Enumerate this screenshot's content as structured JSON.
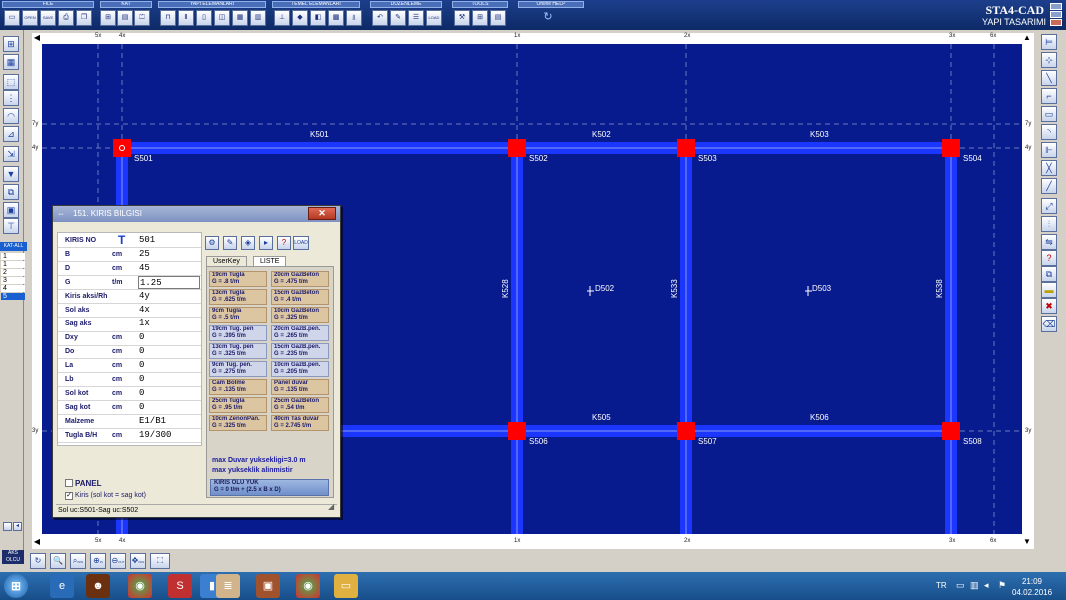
{
  "app": {
    "brand": "STA4-CAD",
    "brand_sub": "YAPI TASARIMI"
  },
  "toolbar_groups": [
    {
      "title": "FILE"
    },
    {
      "title": "KAT"
    },
    {
      "title": "YAPI ELEMANLARI"
    },
    {
      "title": "TEMEL ELEMANLARI"
    },
    {
      "title": "DUZENLEME"
    },
    {
      "title": "TOOLS"
    },
    {
      "title": "Online HELP"
    }
  ],
  "toolbar_buttons": {
    "open": "OPEN",
    "save": "SAVE",
    "load": "LOAD",
    "load2": "LOAD"
  },
  "left": {
    "kat_all": "KAT-ALL",
    "floors": [
      "1",
      "1",
      "2",
      "3",
      "4",
      "5"
    ],
    "selected_floor_index": 5
  },
  "axes": {
    "top": [
      "5x",
      "4x",
      "1x",
      "2x",
      "3x",
      "6x"
    ],
    "left": [
      "7y",
      "4y",
      "3y"
    ],
    "right": [
      "7y",
      "4y",
      "3y"
    ]
  },
  "plan": {
    "beams_h": [
      "K501",
      "K502",
      "K503",
      "K505",
      "K506"
    ],
    "beams_v": [
      "K528",
      "K533",
      "K538"
    ],
    "columns": [
      "S501",
      "S502",
      "S503",
      "S504",
      "S506",
      "S507",
      "S508"
    ],
    "slabs": [
      "D502",
      "D503"
    ]
  },
  "dialog": {
    "title": "151. KIRIS BILGISI",
    "close": "✕",
    "fields": [
      {
        "label": "KIRIS NO",
        "unit": "",
        "value": "501"
      },
      {
        "label": "B",
        "unit": "cm",
        "value": "25"
      },
      {
        "label": "D",
        "unit": "cm",
        "value": "45"
      },
      {
        "label": "G",
        "unit": "t/m",
        "value": "1.25"
      },
      {
        "label": "Kiris aksi/Rh",
        "unit": "",
        "value": "4y"
      },
      {
        "label": "Sol aks",
        "unit": "",
        "value": "4x"
      },
      {
        "label": "Sag aks",
        "unit": "",
        "value": "1x"
      },
      {
        "label": "Dxy",
        "unit": "cm",
        "value": "0"
      },
      {
        "label": "Do",
        "unit": "cm",
        "value": "0"
      },
      {
        "label": "La",
        "unit": "cm",
        "value": "0"
      },
      {
        "label": "Lb",
        "unit": "cm",
        "value": "0"
      },
      {
        "label": "Sol kot",
        "unit": "cm",
        "value": "0"
      },
      {
        "label": "Sag kot",
        "unit": "cm",
        "value": "0"
      },
      {
        "label": "Malzeme",
        "unit": "",
        "value": "E1/B1"
      },
      {
        "label": "Tugla B/H",
        "unit": "cm",
        "value": "19/300"
      }
    ],
    "panel_label": "PANEL",
    "kiris_check_label": "Kiris  (sol kot = sag kot)",
    "status": "Sol uc:S501-Sag uc:S502",
    "tabs": [
      "UserKey",
      "LISTE"
    ],
    "userkeys": [
      {
        "name": "19cm Tugla",
        "g": "G = .8  t/m",
        "style": "tan"
      },
      {
        "name": "20cm GazBeton",
        "g": "G = .475  t/m",
        "style": "tan"
      },
      {
        "name": "13cm Tugla",
        "g": "G = .625  t/m",
        "style": "tan"
      },
      {
        "name": "15cm GazBeton",
        "g": "G = .4  t/m",
        "style": "tan"
      },
      {
        "name": "9cm Tugla",
        "g": "G = .5  t/m",
        "style": "tan"
      },
      {
        "name": "10cm GazBeton",
        "g": "G = .325  t/m",
        "style": "tan"
      },
      {
        "name": "19cm Tug. pen",
        "g": "G = .395  t/m",
        "style": "blue"
      },
      {
        "name": "20cm GazB.pen.",
        "g": "G = .265  t/m",
        "style": "blue"
      },
      {
        "name": "13cm Tug. pen",
        "g": "G = .325  t/m",
        "style": "blue"
      },
      {
        "name": "15cm GazB.pen.",
        "g": "G = .235  t/m",
        "style": "blue"
      },
      {
        "name": "9cm Tug. pen.",
        "g": "G = .275  t/m",
        "style": "blue"
      },
      {
        "name": "10cm GazB.pen.",
        "g": "G = .205  t/m",
        "style": "blue"
      },
      {
        "name": "Cam Bolme",
        "g": "G = .135  t/m",
        "style": "tan"
      },
      {
        "name": "Panel duvar",
        "g": "G = .135  t/m",
        "style": "tan"
      },
      {
        "name": "25cm Tugla",
        "g": "G = .95  t/m",
        "style": "tan"
      },
      {
        "name": "25cm GazBeton",
        "g": "G = .54  t/m",
        "style": "tan"
      },
      {
        "name": "10cm ZenonPan.",
        "g": "G = .325  t/m",
        "style": "tan"
      },
      {
        "name": "40cm Tas duvar",
        "g": "G = 2.745  t/m",
        "style": "tan"
      }
    ],
    "max_info_1": "max Duvar yuksekligi=3.0 m",
    "max_info_2": "max yukseklik alinmistir",
    "olu_title": "KIRIS OLU YUK",
    "olu_formula": "G = 0  t/m  +  (2.5 x B x D)"
  },
  "bottom": {
    "aks": "AKS",
    "olcu": "OLCU",
    "zoom_buttons": [
      "ALL",
      "WIN",
      "IN",
      "OUT",
      "PAN"
    ]
  },
  "taskbar": {
    "lang": "TR",
    "time": "21:09",
    "date": "04.02.2016"
  },
  "colors": {
    "canvas_bg": "#071a8e",
    "beam": "#1a36ff",
    "column": "#ff0000",
    "grid": "#6a7ab8"
  }
}
